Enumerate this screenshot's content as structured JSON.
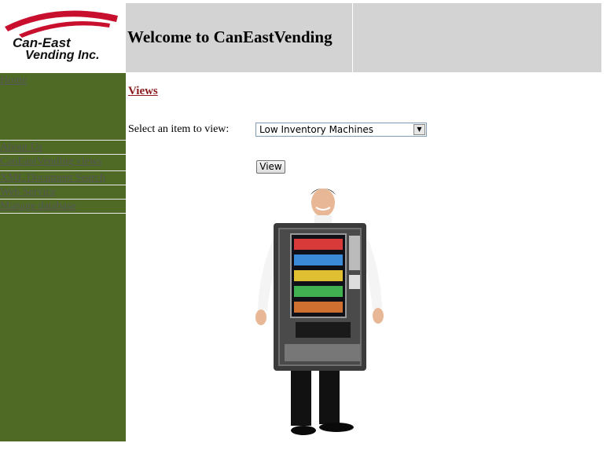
{
  "logo": {
    "line1": "Can-East",
    "line2": "Vending Inc.",
    "accent_color": "#c8102e"
  },
  "header": {
    "title": "Welcome to CanEastVending"
  },
  "sidebar": {
    "background_color": "#4e6a24",
    "items": [
      {
        "label": "Home"
      },
      {
        "label": "About Us"
      },
      {
        "label": "CanEastVending views"
      },
      {
        "label": "XML Document Search"
      },
      {
        "label": "Web Service"
      },
      {
        "label": "Manage database"
      }
    ]
  },
  "main": {
    "section_title": "Views",
    "select_label": "Select an item to view:",
    "select_value": "Low Inventory Machines",
    "button_label": "View",
    "image_icon": "vending-machine-costume-image"
  }
}
